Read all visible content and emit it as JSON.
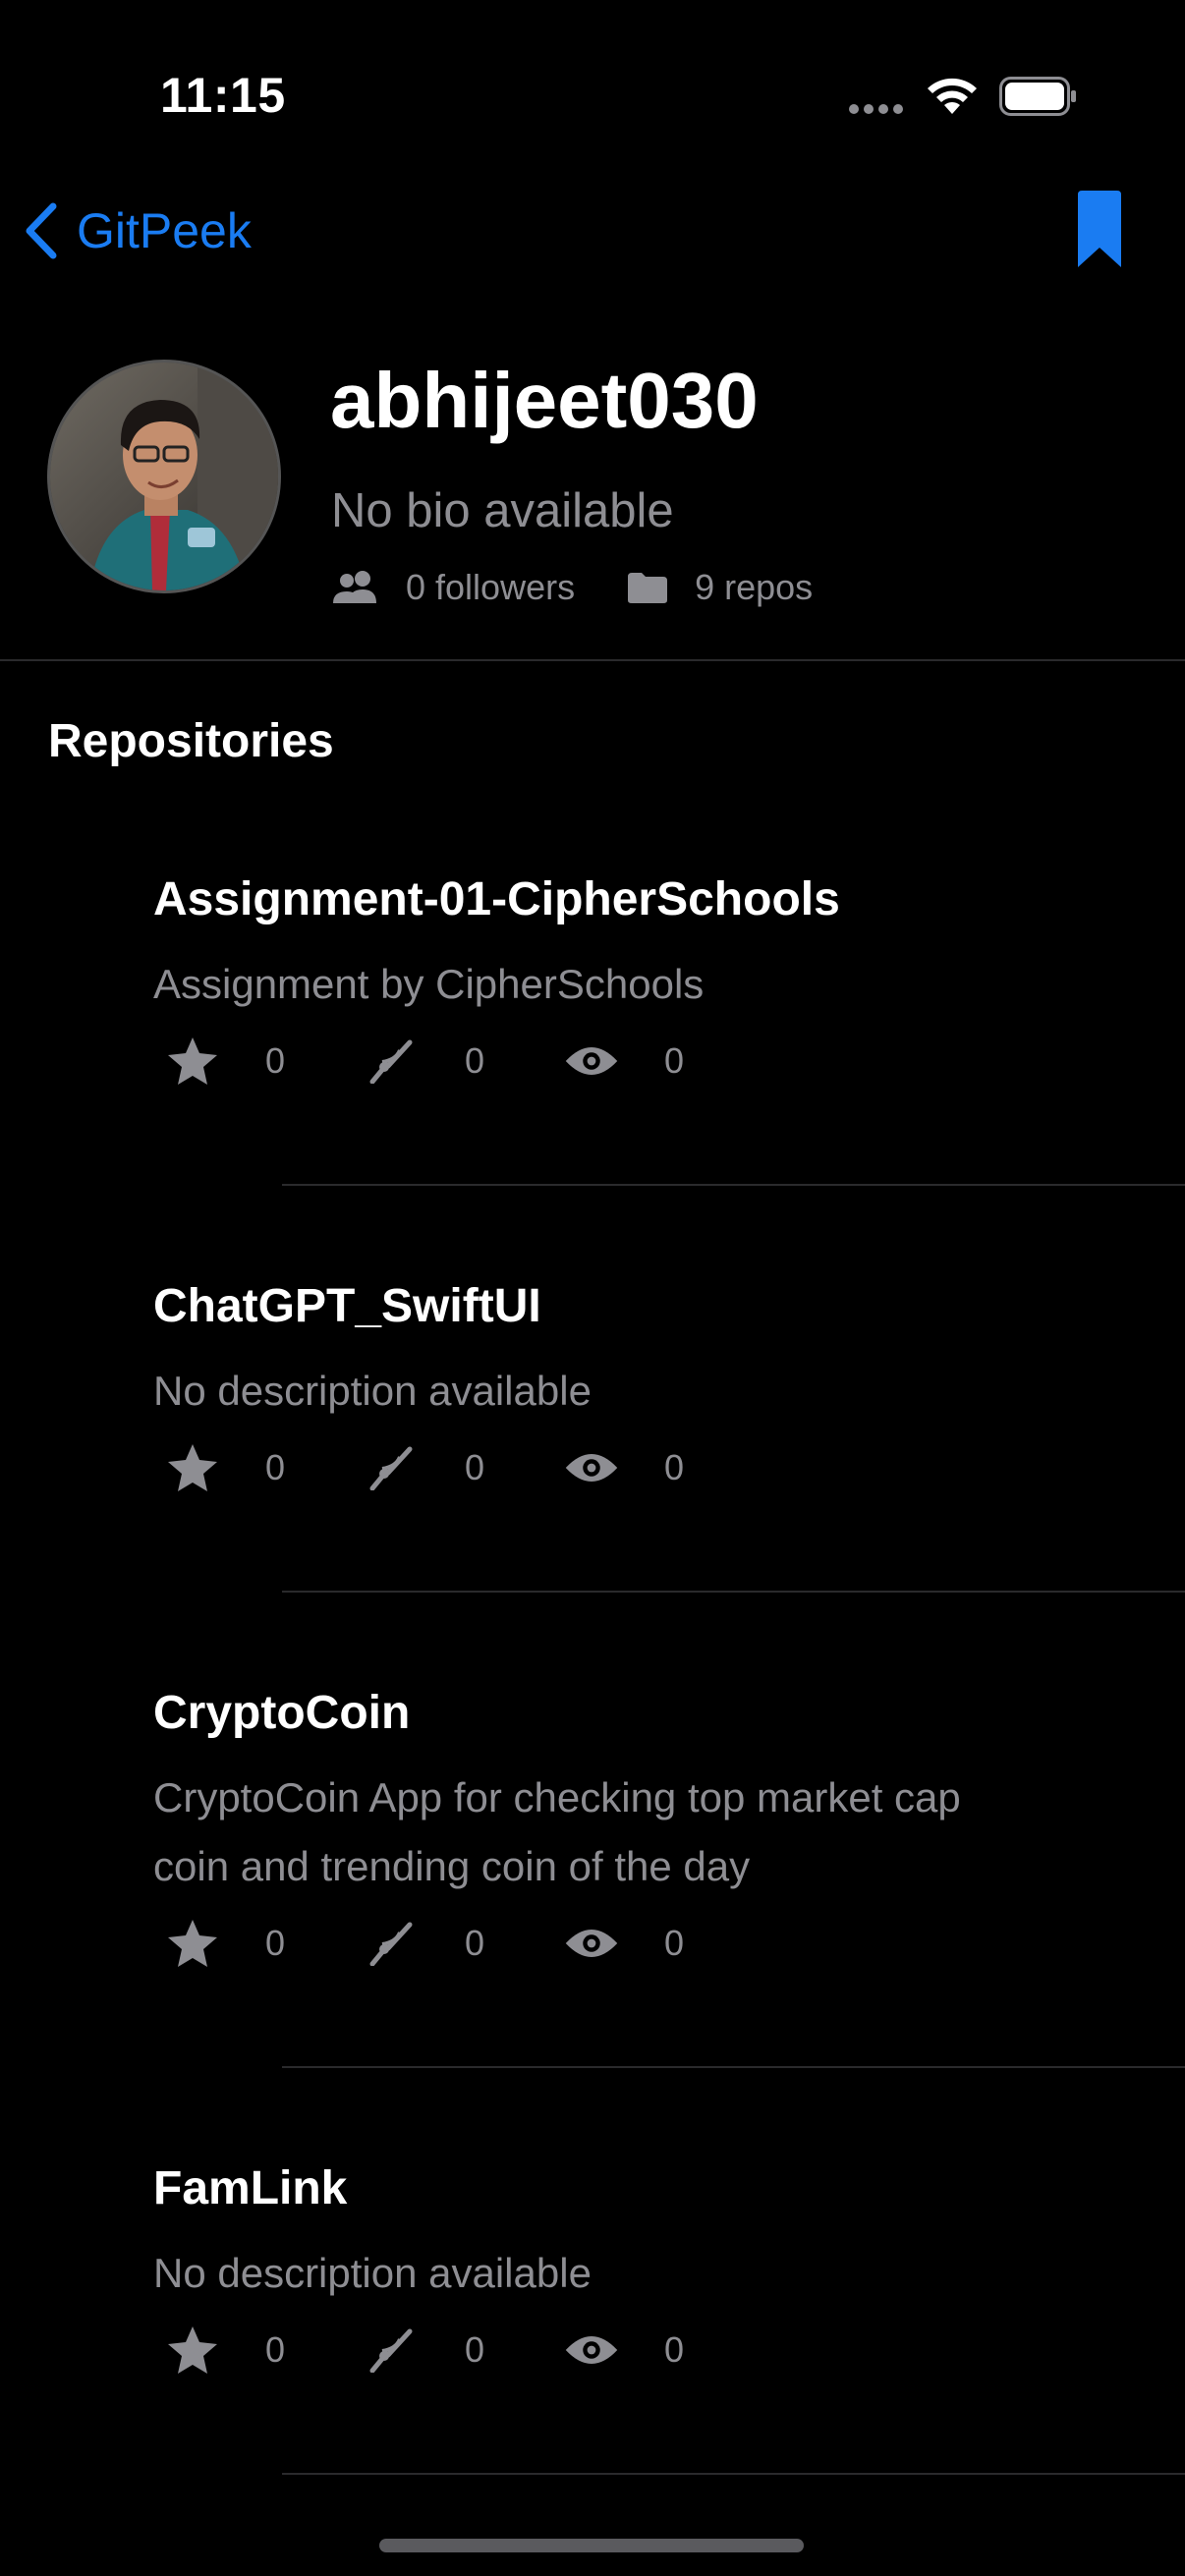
{
  "status_bar": {
    "time": "11:15"
  },
  "nav": {
    "back_label": "GitPeek"
  },
  "profile": {
    "username": "abhijeet030",
    "bio": "No bio available",
    "followers": "0 followers",
    "repos": "9 repos"
  },
  "section_title": "Repositories",
  "repos": [
    {
      "name": "Assignment-01-CipherSchools",
      "description": "Assignment by CipherSchools",
      "stars": "0",
      "forks": "0",
      "watchers": "0"
    },
    {
      "name": "ChatGPT_SwiftUI",
      "description": "No description available",
      "stars": "0",
      "forks": "0",
      "watchers": "0"
    },
    {
      "name": "CryptoCoin",
      "description": "CryptoCoin App for checking top market cap coin and trending coin of the day",
      "stars": "0",
      "forks": "0",
      "watchers": "0"
    },
    {
      "name": "FamLink",
      "description": "No description available",
      "stars": "0",
      "forks": "0",
      "watchers": "0"
    }
  ],
  "colors": {
    "accent": "#1a7cf2",
    "secondary_text": "#8e8e93",
    "background": "#000000"
  }
}
